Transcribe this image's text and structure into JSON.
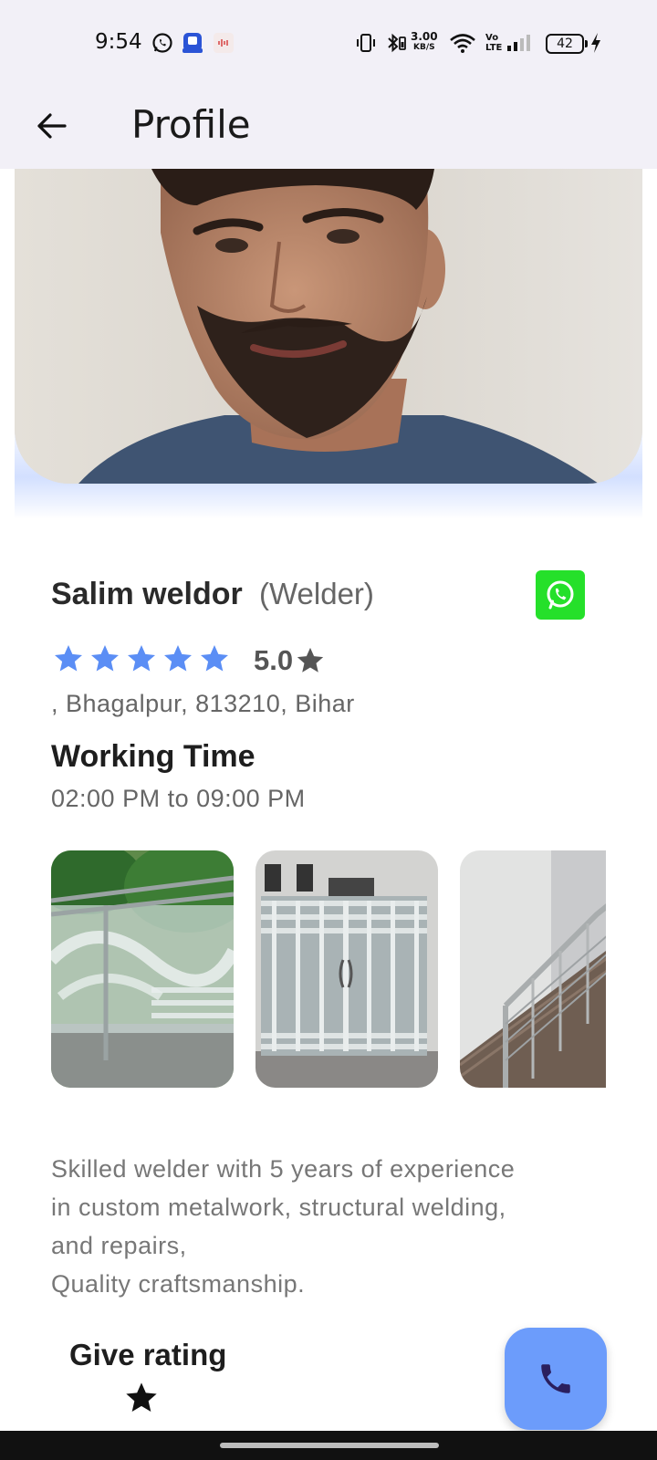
{
  "status_bar": {
    "time": "9:54",
    "speed_value": "3.00",
    "speed_unit": "KB/S",
    "volte_top": "Vo",
    "volte_bottom": "LTE",
    "battery": "42"
  },
  "app_bar": {
    "title": "Profile",
    "back_icon": "arrow-left-icon"
  },
  "profile": {
    "name": "Salim weldor",
    "role": "(Welder)",
    "rating_value": "5.0",
    "stars_filled": 5,
    "stars_total": 5,
    "star_color": "#5b8ef5",
    "address": ", Bhagalpur, 813210, Bihar",
    "whatsapp_icon": "whatsapp-icon",
    "whatsapp_color": "#25e02a"
  },
  "working_time": {
    "title": "Working Time",
    "value": "02:00 PM to 09:00 PM"
  },
  "gallery": [
    {
      "name": "glass-railing"
    },
    {
      "name": "steel-gate"
    },
    {
      "name": "stair-railing"
    }
  ],
  "description": {
    "lines": [
      "Skilled welder with 5 years of experience",
      "in custom metalwork, structural welding,",
      "and repairs,",
      "Quality craftsmanship."
    ]
  },
  "give_rating": {
    "title": "Give rating"
  },
  "fab": {
    "icon": "phone-icon",
    "color": "#6c9cfb"
  }
}
